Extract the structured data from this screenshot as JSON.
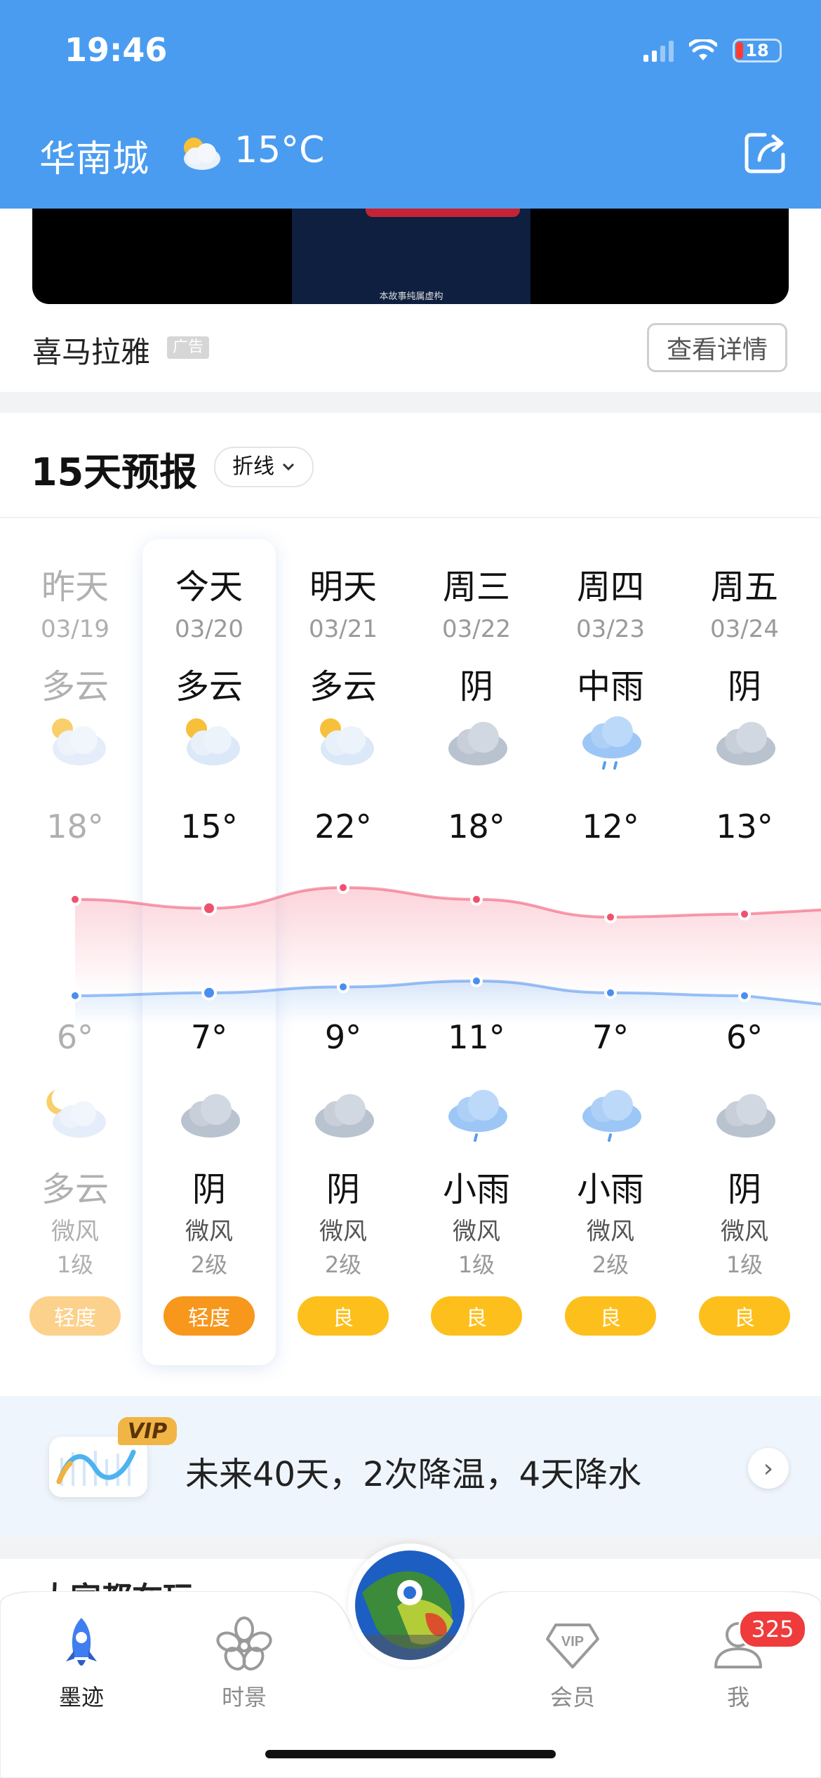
{
  "status_bar": {
    "time": "19:46",
    "battery": "18"
  },
  "header": {
    "city": "华南城",
    "temp": "15°C",
    "weather_icon": "partly-cloudy-icon",
    "share_icon": "share-icon"
  },
  "ad": {
    "caption": "本故事纯属虚构",
    "brand": "喜马拉雅",
    "tag": "广告",
    "detail_label": "查看详情"
  },
  "forecast": {
    "title": "15天预报",
    "mode_label": "折线",
    "days": [
      {
        "day": "昨天",
        "date": "03/19",
        "day_cond": "多云",
        "day_icon": "partly-cloudy-icon",
        "high": "18°",
        "low": "6°",
        "night_icon": "cloudy-night-icon",
        "night_cond": "多云",
        "wind": "微风",
        "wind_level": "1级",
        "aqi": "轻度",
        "aqi_color": "#fcd18b"
      },
      {
        "day": "今天",
        "date": "03/20",
        "day_cond": "多云",
        "day_icon": "partly-cloudy-icon",
        "high": "15°",
        "low": "7°",
        "night_icon": "overcast-icon",
        "night_cond": "阴",
        "wind": "微风",
        "wind_level": "2级",
        "aqi": "轻度",
        "aqi_color": "#f7971c"
      },
      {
        "day": "明天",
        "date": "03/21",
        "day_cond": "多云",
        "day_icon": "partly-cloudy-icon",
        "high": "22°",
        "low": "9°",
        "night_icon": "overcast-icon",
        "night_cond": "阴",
        "wind": "微风",
        "wind_level": "2级",
        "aqi": "良",
        "aqi_color": "#fdbf1b"
      },
      {
        "day": "周三",
        "date": "03/22",
        "day_cond": "阴",
        "day_icon": "overcast-icon",
        "high": "18°",
        "low": "11°",
        "night_icon": "light-rain-icon",
        "night_cond": "小雨",
        "wind": "微风",
        "wind_level": "1级",
        "aqi": "良",
        "aqi_color": "#fdbf1b"
      },
      {
        "day": "周四",
        "date": "03/23",
        "day_cond": "中雨",
        "day_icon": "moderate-rain-icon",
        "high": "12°",
        "low": "7°",
        "night_icon": "light-rain-icon",
        "night_cond": "小雨",
        "wind": "微风",
        "wind_level": "2级",
        "aqi": "良",
        "aqi_color": "#fdbf1b"
      },
      {
        "day": "周五",
        "date": "03/24",
        "day_cond": "阴",
        "day_icon": "overcast-icon",
        "high": "13°",
        "low": "6°",
        "night_icon": "overcast-icon",
        "night_cond": "阴",
        "wind": "微风",
        "wind_level": "1级",
        "aqi": "良",
        "aqi_color": "#fdbf1b"
      }
    ]
  },
  "chart_data": {
    "type": "line",
    "categories": [
      "03/19",
      "03/20",
      "03/21",
      "03/22",
      "03/23",
      "03/24"
    ],
    "series": [
      {
        "values": [
          18,
          15,
          22,
          18,
          12,
          13
        ],
        "color": "#f0506e"
      },
      {
        "values": [
          6,
          7,
          9,
          11,
          7,
          6
        ],
        "color": "#4a8ff0"
      }
    ]
  },
  "vip_banner": {
    "badge": "VIP",
    "text": "未来40天，2次降温，4天降水"
  },
  "next_section_peek": "大家都在玩",
  "tabbar": {
    "items": [
      {
        "label": "墨迹",
        "icon": "rocket-icon"
      },
      {
        "label": "时景",
        "icon": "flower-icon"
      },
      {
        "label": "会员",
        "icon": "vip-diamond-icon"
      },
      {
        "label": "我",
        "icon": "profile-icon"
      }
    ],
    "badge": "325"
  }
}
